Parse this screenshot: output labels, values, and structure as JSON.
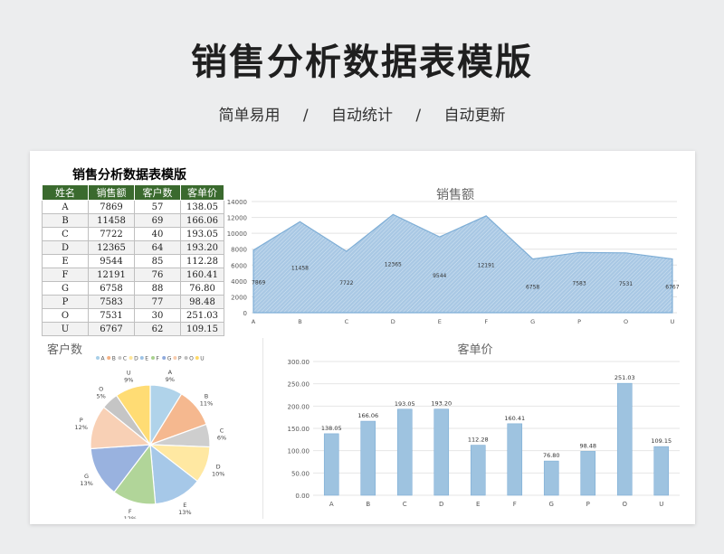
{
  "header": {
    "title": "销售分析数据表模版",
    "sub": [
      "简单易用",
      "/",
      "自动统计",
      "/",
      "自动更新"
    ]
  },
  "sheet": {
    "title": "销售分析数据表模版",
    "columns": [
      "姓名",
      "销售额",
      "客户数",
      "客单价"
    ],
    "rows": [
      [
        "A",
        "7869",
        "57",
        "138.05"
      ],
      [
        "B",
        "11458",
        "69",
        "166.06"
      ],
      [
        "C",
        "7722",
        "40",
        "193.05"
      ],
      [
        "D",
        "12365",
        "64",
        "193.20"
      ],
      [
        "E",
        "9544",
        "85",
        "112.28"
      ],
      [
        "F",
        "12191",
        "76",
        "160.41"
      ],
      [
        "G",
        "6758",
        "88",
        "76.80"
      ],
      [
        "P",
        "7583",
        "77",
        "98.48"
      ],
      [
        "O",
        "7531",
        "30",
        "251.03"
      ],
      [
        "U",
        "6767",
        "62",
        "109.15"
      ]
    ]
  },
  "chart_data": [
    {
      "type": "area",
      "title": "销售额",
      "categories": [
        "A",
        "B",
        "C",
        "D",
        "E",
        "F",
        "G",
        "P",
        "O",
        "U"
      ],
      "values": [
        7869,
        11458,
        7722,
        12365,
        9544,
        12191,
        6758,
        7583,
        7531,
        6767
      ],
      "ylim": [
        0,
        14000
      ],
      "yticks": [
        "0",
        "2000",
        "4000",
        "6000",
        "8000",
        "10000",
        "12000",
        "14000"
      ],
      "color": "#a9c8e4"
    },
    {
      "type": "pie",
      "title": "客户数",
      "categories": [
        "A",
        "B",
        "C",
        "D",
        "E",
        "F",
        "G",
        "P",
        "O",
        "U"
      ],
      "values": [
        57,
        69,
        40,
        64,
        85,
        76,
        88,
        77,
        30,
        62
      ],
      "pct": [
        "9%",
        "11%",
        "6%",
        "10%",
        "13%",
        "12%",
        "13%",
        "12%",
        "5%",
        "9%"
      ],
      "legend": "top",
      "colors": [
        "#a8cfe8",
        "#f4b183",
        "#c9c9c9",
        "#ffe699",
        "#9dc3e6",
        "#a9d18e",
        "#8faadc",
        "#f8cbad",
        "#bfbfbf",
        "#ffd966"
      ]
    },
    {
      "type": "bar",
      "title": "客单价",
      "categories": [
        "A",
        "B",
        "C",
        "D",
        "E",
        "F",
        "G",
        "P",
        "O",
        "U"
      ],
      "values": [
        138.05,
        166.06,
        193.05,
        193.2,
        112.28,
        160.41,
        76.8,
        98.48,
        251.03,
        109.15
      ],
      "labels": [
        "138.05",
        "166.06",
        "193.05",
        "193.20",
        "112.28",
        "160.41",
        "76.80",
        "98.48",
        "251.03",
        "109.15"
      ],
      "ylim": [
        0,
        300
      ],
      "yticks": [
        "0.00",
        "50.00",
        "100.00",
        "150.00",
        "200.00",
        "250.00",
        "300.00"
      ],
      "color": "#9ec3e0"
    }
  ]
}
